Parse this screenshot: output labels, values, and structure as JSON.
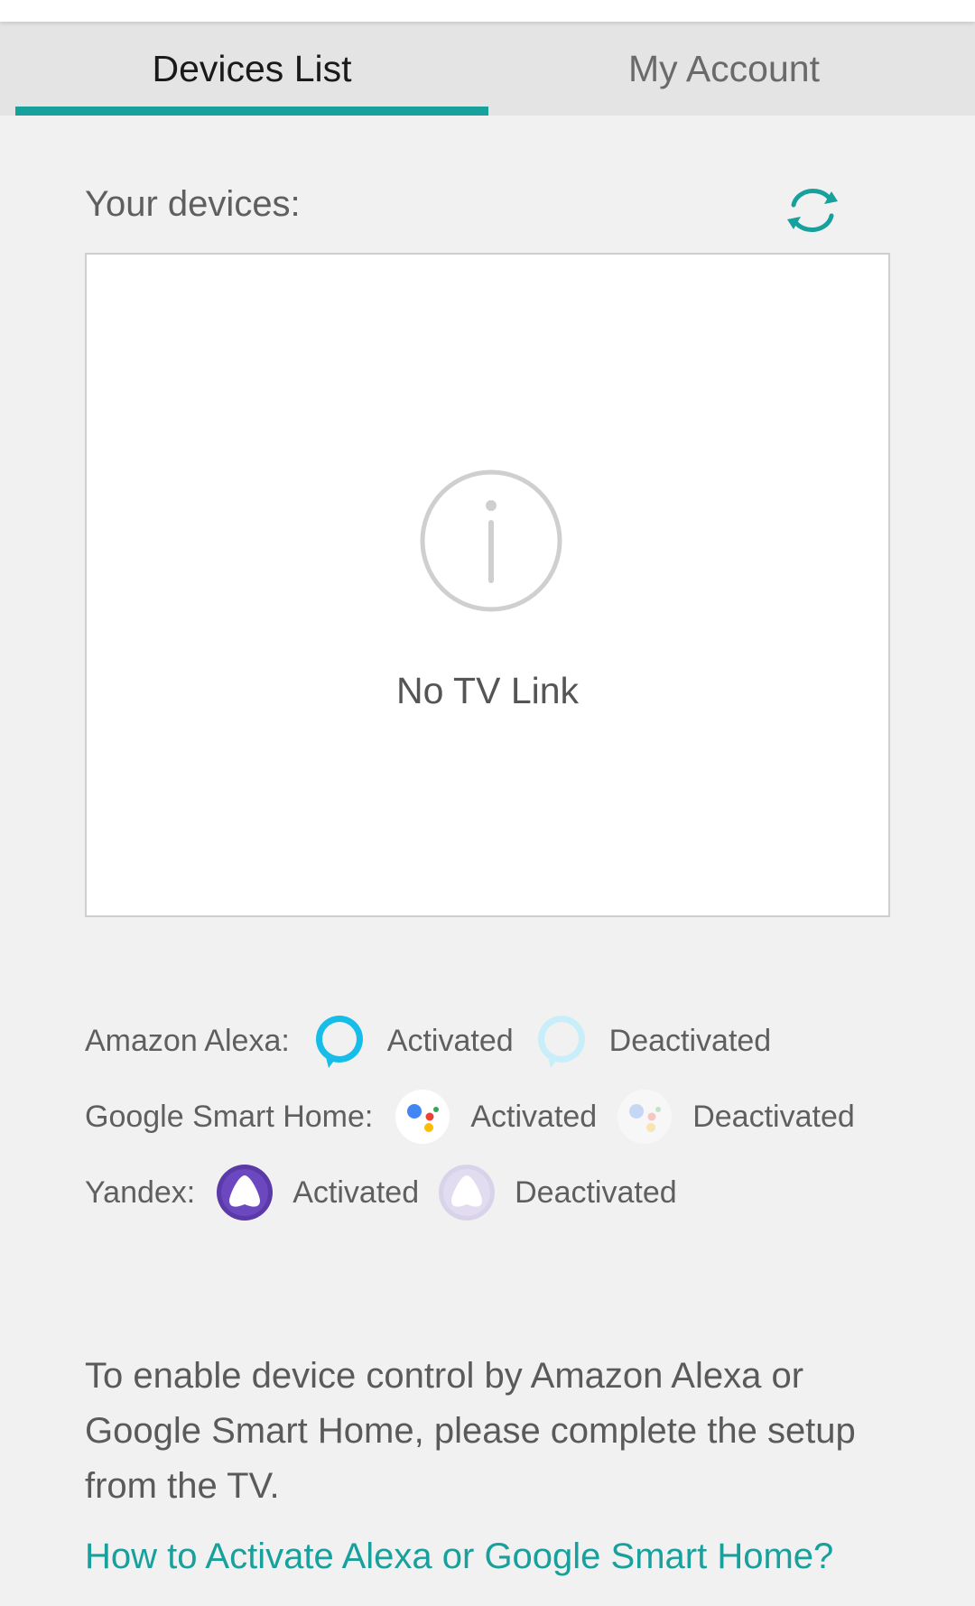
{
  "tabs": {
    "devices_list": "Devices List",
    "my_account": "My Account",
    "active": "devices_list"
  },
  "devices": {
    "label": "Your devices:",
    "empty_text": "No TV Link",
    "refresh_icon": "refresh-icon",
    "empty_icon": "info-icon"
  },
  "services": [
    {
      "label": "Amazon Alexa:",
      "activated": "Activated",
      "deactivated": "Deactivated",
      "icon": "alexa-logo-icon"
    },
    {
      "label": "Google Smart Home:",
      "activated": "Activated",
      "deactivated": "Deactivated",
      "icon": "google-assistant-logo-icon"
    },
    {
      "label": "Yandex:",
      "activated": "Activated",
      "deactivated": "Deactivated",
      "icon": "yandex-alice-logo-icon"
    }
  ],
  "info": {
    "text": "To enable device control by Amazon Alexa or Google Smart Home, please complete the setup from the TV.",
    "link": "How to Activate Alexa or Google Smart Home?"
  },
  "colors": {
    "accent": "#17a09c",
    "alexa": "#16bde9",
    "yandex": "#5b3aa8",
    "google_blue": "#4285f4",
    "google_red": "#ea4335",
    "google_yellow": "#fbbc05",
    "google_green": "#34a853"
  }
}
